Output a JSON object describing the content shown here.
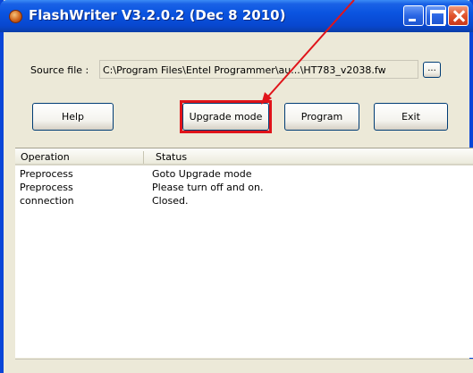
{
  "window": {
    "title": "FlashWriter V3.2.0.2 (Dec  8 2010)"
  },
  "source": {
    "label": "Source file :",
    "value": "C:\\Program Files\\Entel Programmer\\au...\\HT783_v2038.fw",
    "browse_label": "..."
  },
  "buttons": {
    "help": "Help",
    "upgrade": "Upgrade mode",
    "program": "Program",
    "exit": "Exit"
  },
  "log": {
    "columns": [
      "Operation",
      "Status"
    ],
    "rows": [
      {
        "operation": "Preprocess",
        "status": "Goto Upgrade mode"
      },
      {
        "operation": "Preprocess",
        "status": "Please turn off and on."
      },
      {
        "operation": "connection",
        "status": "Closed."
      }
    ]
  },
  "colors": {
    "annotation": "#e0141a",
    "titlebar": "#0a54e0"
  },
  "icons": [
    "app-icon",
    "minimize-icon",
    "maximize-icon",
    "close-icon",
    "annotation-arrow"
  ]
}
